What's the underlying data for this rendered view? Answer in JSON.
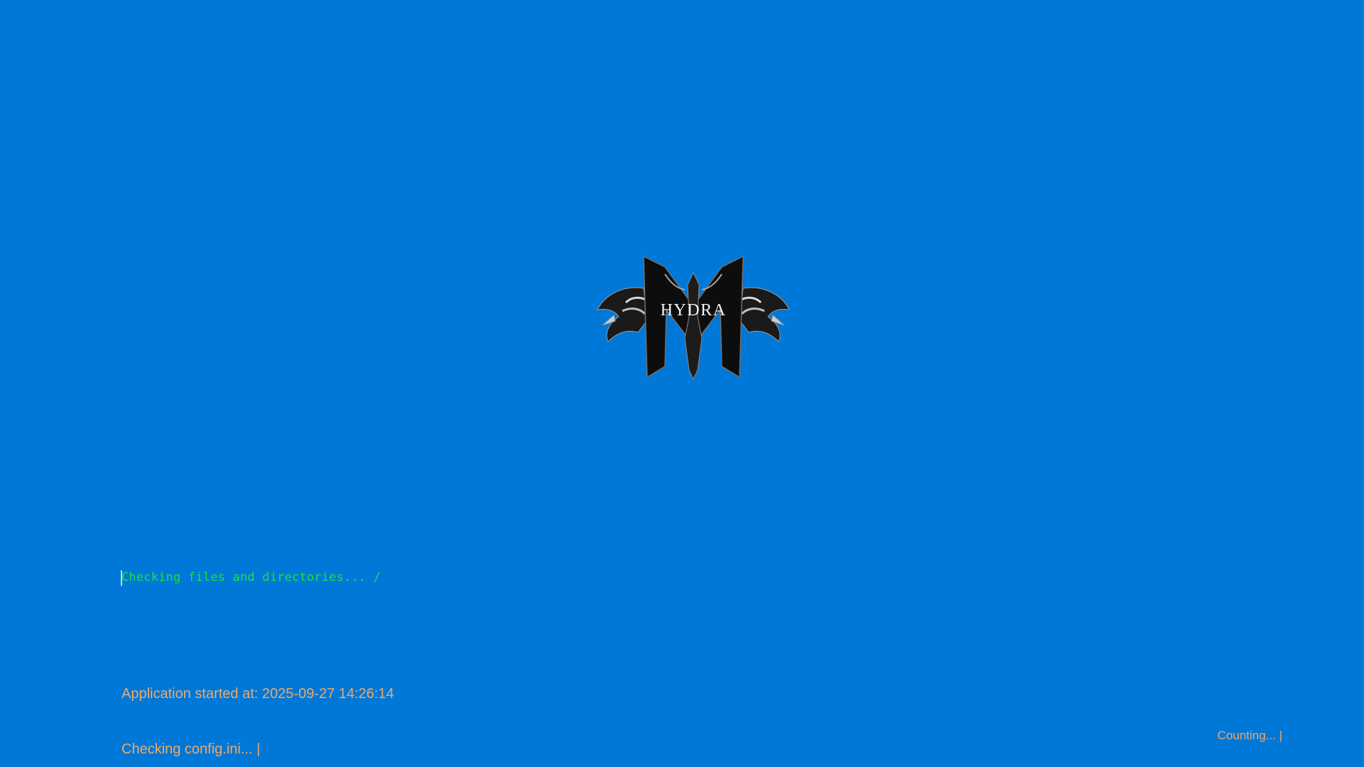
{
  "splash": {
    "background_color": "#0078d7",
    "logo": {
      "icon": "hydra-logo-icon",
      "text": "HYDRA"
    },
    "status_line": "Checking files and directories... /",
    "status_color": "#1be04a",
    "log_lines": [
      "Application started at: 2025-09-27 14:26:14",
      "Checking config.ini... |"
    ],
    "log_color": "#f0a868",
    "counter_text": "Counting... |"
  }
}
